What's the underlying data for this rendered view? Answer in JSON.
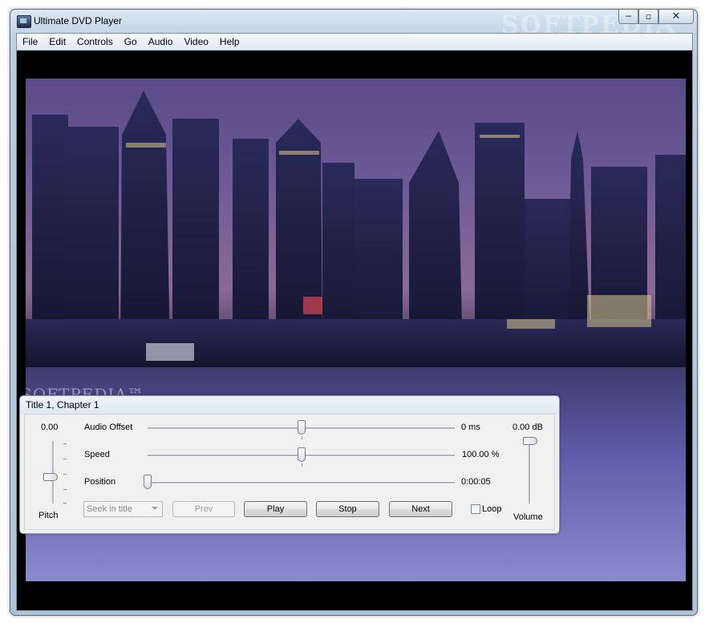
{
  "window": {
    "title": "Ultimate DVD Player",
    "caption_buttons": {
      "minimize": "─",
      "maximize": "▫",
      "close": "✕"
    }
  },
  "watermark": "SOFTPEDIA",
  "video_watermark": "SOFTPEDIA™",
  "menu": [
    "File",
    "Edit",
    "Controls",
    "Go",
    "Audio",
    "Video",
    "Help"
  ],
  "panel": {
    "title": "Title 1, Chapter 1",
    "pitch": {
      "value": "0.00",
      "label": "Pitch",
      "level": 0.42
    },
    "volume": {
      "value": "0.00 dB",
      "label": "Volume",
      "level": 1.0
    },
    "sliders": [
      {
        "label": "Audio Offset",
        "value": "0 ms",
        "level": 0.5
      },
      {
        "label": "Speed",
        "value": "100.00 %",
        "level": 0.5
      },
      {
        "label": "Position",
        "value": "0:00:05",
        "level": 0.0
      }
    ],
    "seek_combo": "Seek in title",
    "buttons": {
      "prev": "Prev",
      "play": "Play",
      "stop": "Stop",
      "next": "Next"
    },
    "loop_label": "Loop",
    "loop_checked": false
  },
  "icons": {
    "app": "dvd-player-icon",
    "dropdown": "chevron-down-icon"
  }
}
